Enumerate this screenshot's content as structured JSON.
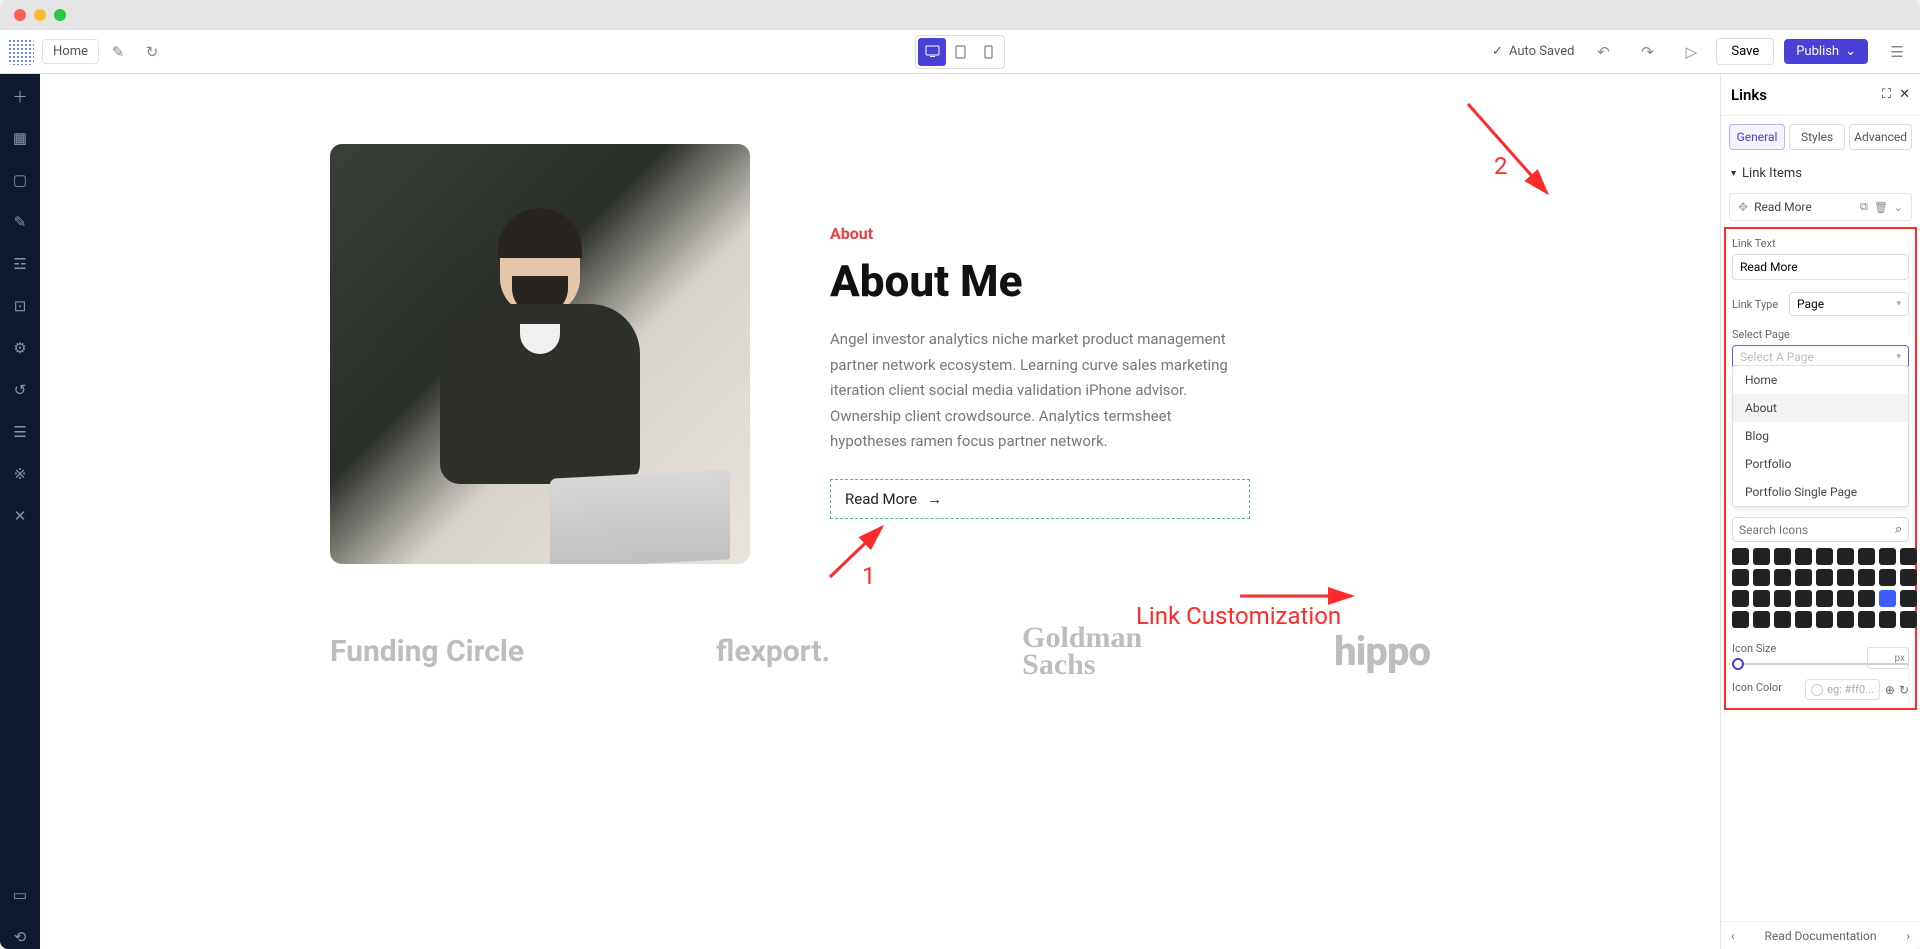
{
  "topbar": {
    "breadcrumb": "Home",
    "auto_saved": "Auto Saved",
    "save": "Save",
    "publish": "Publish"
  },
  "canvas": {
    "eyebrow": "About",
    "heading": "About Me",
    "body": "Angel investor analytics niche market product management partner network ecosystem. Learning curve sales marketing iteration client social media validation iPhone advisor. Ownership client crowdsource. Analytics termsheet hypotheses ramen focus partner network.",
    "readmore": "Read More",
    "brands": [
      "Funding Circle",
      "flexport.",
      "Goldman\nSachs",
      "hippo"
    ]
  },
  "annotations": {
    "one": "1",
    "two": "2",
    "text": "Link Customization"
  },
  "panel": {
    "title": "Links",
    "tabs": {
      "general": "General",
      "styles": "Styles",
      "advanced": "Advanced"
    },
    "section_link_items": "Link Items",
    "item_label": "Read More",
    "field_link_text": "Link Text",
    "link_text_value": "Read More",
    "field_link_type": "Link Type",
    "link_type_value": "Page",
    "field_select_page": "Select Page",
    "select_page_placeholder": "Select A Page",
    "pages": [
      "Home",
      "About",
      "Blog",
      "Portfolio",
      "Portfolio Single Page"
    ],
    "search_icons_placeholder": "Search Icons",
    "field_icon_size": "Icon Size",
    "px_unit": "px",
    "field_icon_color": "Icon Color",
    "icon_color_placeholder": "eg: #ff0...",
    "footer_doc": "Read Documentation"
  }
}
